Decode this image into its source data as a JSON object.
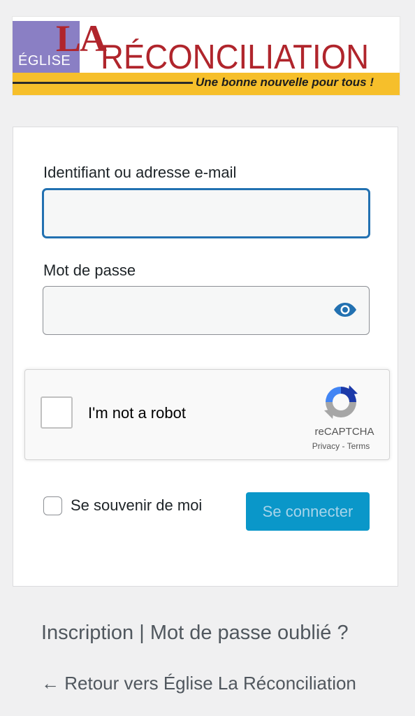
{
  "logo": {
    "eglise": "ÉGLISE",
    "la": "LA",
    "name": "RÉCONCILIATION",
    "tagline": "Une bonne nouvelle pour tous !",
    "colors": {
      "purple": "#8a7fc4",
      "red": "#b0252c",
      "yellow": "#f6bf2b"
    }
  },
  "login_form": {
    "username_label": "Identifiant ou adresse e-mail",
    "username_value": "",
    "password_label": "Mot de passe",
    "password_value": "",
    "show_password_icon": "eye-icon",
    "recaptcha": {
      "label": "I'm not a robot",
      "brand": "reCAPTCHA",
      "privacy": "Privacy",
      "separator": " - ",
      "terms": "Terms",
      "checked": false,
      "icon": "recaptcha-logo-icon"
    },
    "remember_label": "Se souvenir de moi",
    "remember_checked": false,
    "submit_label": "Se connecter",
    "accent_color": "#2271b1"
  },
  "footer": {
    "register": "Inscription",
    "separator": " | ",
    "lost_password": "Mot de passe oublié ?",
    "back_arrow": "← ",
    "back_link": "Retour vers Église La Réconciliation"
  }
}
